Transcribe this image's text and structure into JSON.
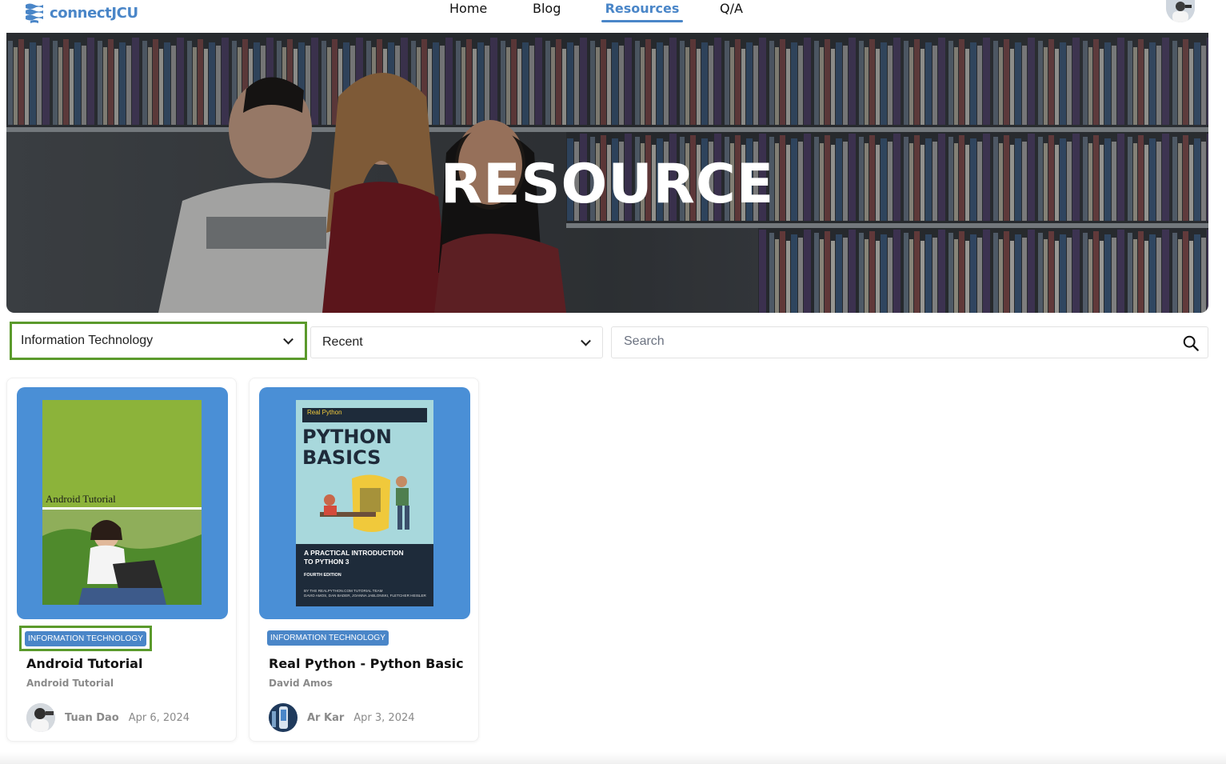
{
  "app": {
    "logo_text": "connectJCU"
  },
  "nav": {
    "home": "Home",
    "blog": "Blog",
    "resources": "Resources",
    "qa": "Q/A",
    "active": "Resources"
  },
  "hero": {
    "title": "RESOURCE"
  },
  "filters": {
    "category": "Information Technology",
    "sort": "Recent",
    "search_placeholder": "Search"
  },
  "cards": [
    {
      "tag": "INFORMATION TECHNOLOGY",
      "title": "Android Tutorial",
      "subtitle": "Android Tutorial",
      "author": "Tuan Dao",
      "date": "Apr 6, 2024",
      "cover_title": "Android Tutorial"
    },
    {
      "tag": "INFORMATION TECHNOLOGY",
      "title": "Real Python - Python Basic",
      "subtitle": "David Amos",
      "author": "Ar Kar",
      "date": "Apr 3, 2024",
      "cover": {
        "brand": "Real Python",
        "line1": "PYTHON",
        "line2": "BASICS",
        "tagline1": "A PRACTICAL INTRODUCTION",
        "tagline2": "TO PYTHON 3",
        "edition": "FOURTH EDITION",
        "credits1": "BY THE REALPYTHON.COM TUTORIAL TEAM",
        "credits2": "DAVID AMOS, DAN BADER, JOANNA JABLONSKI, FLETCHER HEISLER"
      }
    }
  ],
  "colors": {
    "brand_blue": "#4a86c8",
    "highlight_green": "#5b9a2c",
    "thumb_blue": "#4a8fd6"
  }
}
